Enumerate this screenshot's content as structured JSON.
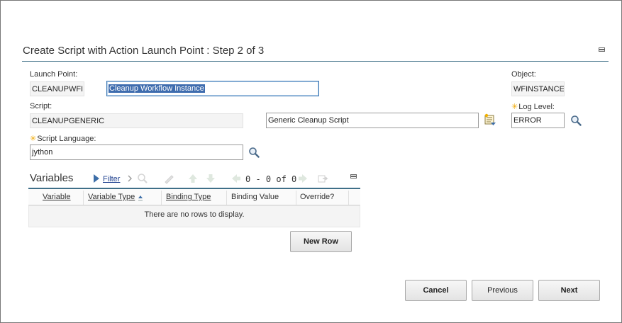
{
  "dialog": {
    "title": "Create Script with Action Launch Point : Step 2 of 3"
  },
  "form": {
    "launch_point_label": "Launch Point:",
    "launch_point_value": "CLEANUPWFIN",
    "launch_point_description": "Cleanup Workflow Instance",
    "object_label": "Object:",
    "object_value": "WFINSTANCE",
    "script_label": "Script:",
    "script_value": "CLEANUPGENERIC",
    "script_description": "Generic Cleanup Script",
    "log_level_label": "Log Level:",
    "log_level_value": "ERROR",
    "script_language_label": "Script Language:",
    "script_language_value": "jython",
    "required_marker": "✳"
  },
  "variables": {
    "title": "Variables",
    "filter_label": "Filter",
    "pager_text": "0 - 0 of 0",
    "columns": [
      "Variable",
      "Variable Type",
      "Binding Type",
      "Binding Value",
      "Override?"
    ],
    "empty_message": "There are no rows to display.",
    "new_row_label": "New Row"
  },
  "footer": {
    "cancel_label": "Cancel",
    "previous_label": "Previous",
    "next_label": "Next"
  },
  "colors": {
    "accent_rule": "#3f6f88",
    "required_star": "#f0a800",
    "link": "#1d3f8f",
    "selection": "#3e6cae"
  }
}
